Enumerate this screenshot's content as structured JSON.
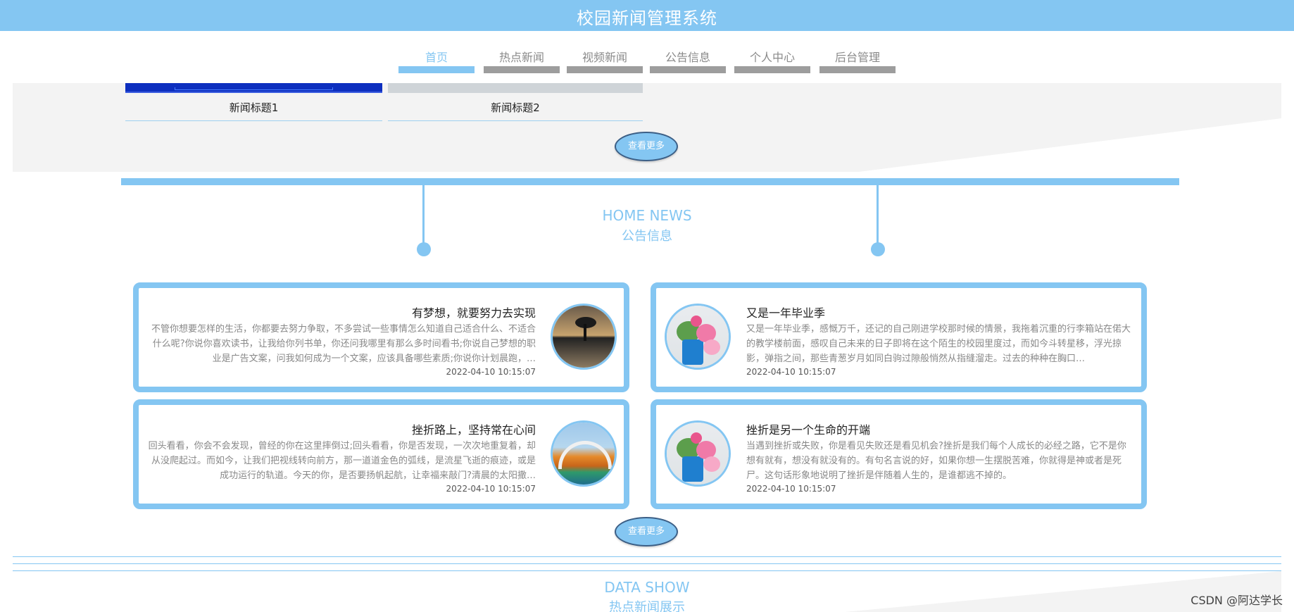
{
  "app": {
    "title": "校园新闻管理系统"
  },
  "nav": {
    "items": [
      {
        "label": "首页",
        "active": true
      },
      {
        "label": "热点新闻"
      },
      {
        "label": "视频新闻"
      },
      {
        "label": "公告信息"
      },
      {
        "label": "个人中心"
      },
      {
        "label": "后台管理"
      }
    ]
  },
  "news": {
    "items": [
      {
        "title": "新闻标题1"
      },
      {
        "title": "新闻标题2"
      }
    ],
    "more_label": "查看更多"
  },
  "notice": {
    "heading_en": "HOME NEWS",
    "heading_cn": "公告信息",
    "more_label": "查看更多",
    "cards": [
      {
        "title": "有梦想，就要努力去实现",
        "body": "不管你想要怎样的生活，你都要去努力争取，不多尝试一些事情怎么知道自己适合什么、不适合什么呢?你说你喜欢读书，让我给你列书单，你还问我哪里有那么多时间看书;你说自己梦想的职业是广告文案，问我如何成为一个文案，应该具备哪些素质;你说你计划晨跑，…",
        "time": "2022-04-10 10:15:07",
        "image_icon": "lone-tree-sunset-image"
      },
      {
        "title": "又是一年毕业季",
        "body": "又是一年毕业季，感慨万千，还记的自己刚进学校那时候的情景，我拖着沉重的行李箱站在偌大的教学楼前面，感叹自己未来的日子即将在这个陌生的校园里度过，而如今斗转星移，浮光掠影，弹指之间，那些青葱岁月如同白驹过隙般悄然从指缝溜走。过去的种种在胸口…",
        "time": "2022-04-10 10:15:07",
        "image_icon": "flower-pot-image"
      },
      {
        "title": "挫折路上，坚持常在心间",
        "body": "回头看看，你会不会发现，曾经的你在这里摔倒过;回头看看，你是否发现，一次次地重复着，却从没爬起过。而如今，让我们把视线转向前方，那一道道金色的弧线，是流星飞逝的痕迹，或是成功运行的轨道。今天的你，是否要扬帆起航，让幸福来敲门?清晨的太阳撒…",
        "time": "2022-04-10 10:15:07",
        "image_icon": "bridge-autumn-image"
      },
      {
        "title": "挫折是另一个生命的开端",
        "body": "当遇到挫折或失败，你是看见失败还是看见机会?挫折是我们每个人成长的必经之路，它不是你想有就有，想没有就没有的。有句名言说的好，如果你想一生摆脱苦难，你就得是神或者是死尸。这句话形象地说明了挫折是伴随着人生的，是谁都逃不掉的。",
        "time": "2022-04-10 10:15:07",
        "image_icon": "flower-pot-image"
      }
    ]
  },
  "data_show": {
    "heading_en": "DATA SHOW",
    "heading_cn": "热点新闻展示"
  },
  "watermark": "CSDN @阿达学长",
  "colors": {
    "accent": "#84c6f2",
    "nav_inactive": "#9d9d9d",
    "panel_bg": "#f3f3f3",
    "button_border": "#3c5f86"
  }
}
